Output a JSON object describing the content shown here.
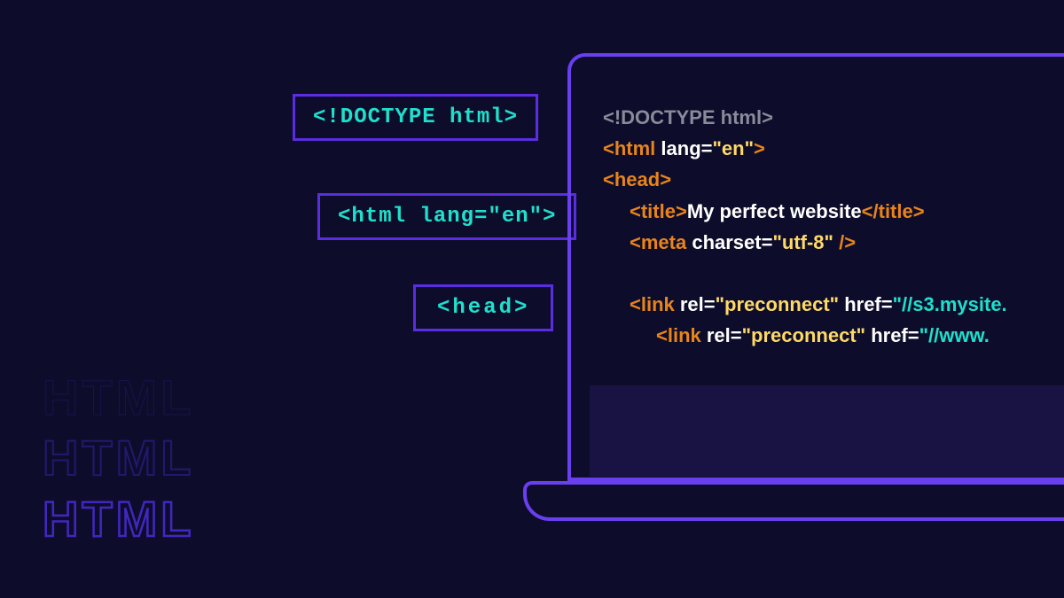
{
  "tags": {
    "doctype": "<!DOCTYPE html>",
    "htmllang": "<html lang=\"en\">",
    "head": "<head>"
  },
  "code": {
    "l1": "<!DOCTYPE html>",
    "l2_open": "<html ",
    "l2_attr": "lang=",
    "l2_val": "\"en\"",
    "l2_close": ">",
    "l3": "<head>",
    "l4_open": "<title>",
    "l4_text": "My perfect website",
    "l4_close": "</title>",
    "l5_open": "<meta ",
    "l5_attr": "charset=",
    "l5_val": "\"utf-8\"",
    "l5_close": " />",
    "l6_open": "<link ",
    "l6_attr1": "rel=",
    "l6_val1": "\"preconnect\"",
    "l6_attr2": " href=",
    "l6_val2": "\"//s3.mysite.",
    "l7_open": "<link ",
    "l7_attr1": "rel=",
    "l7_val1": "\"preconnect\"",
    "l7_attr2": " href=",
    "l7_val2": "\"//www."
  },
  "decor": {
    "label": "HTML"
  }
}
